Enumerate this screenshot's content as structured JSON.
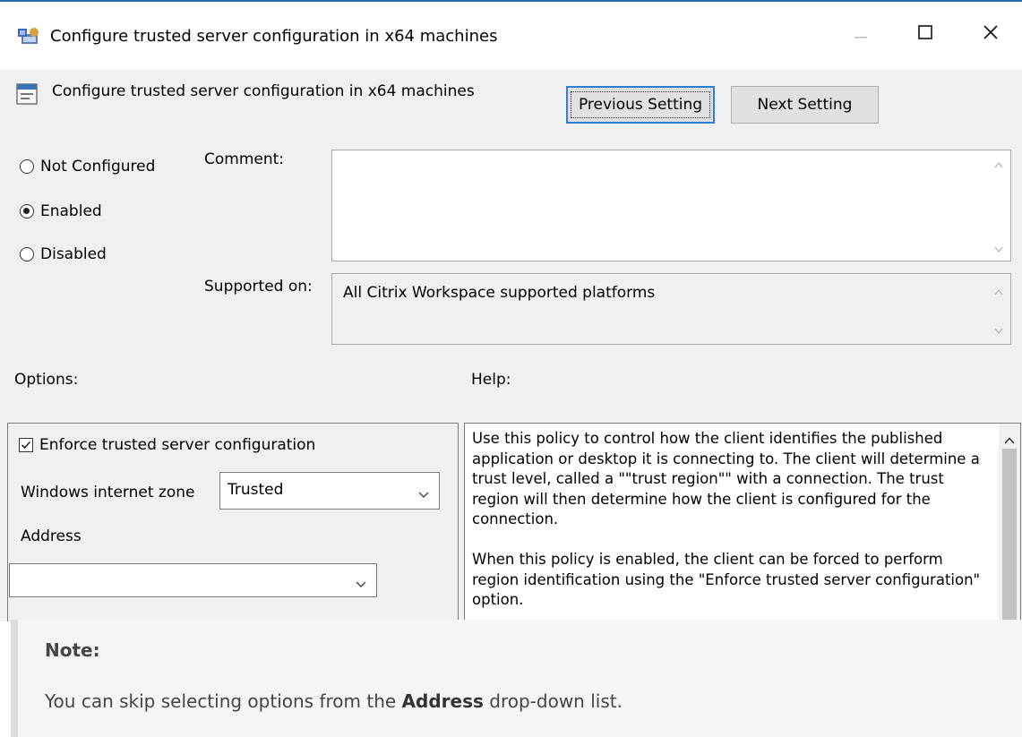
{
  "window": {
    "title": "Configure trusted server configuration in x64 machines",
    "minimize_icon": "minimize-icon",
    "maximize_icon": "maximize-icon",
    "close_icon": "close-icon"
  },
  "setting": {
    "title": "Configure trusted server configuration in x64 machines",
    "previous_label": "Previous Setting",
    "next_label": "Next Setting"
  },
  "state": {
    "options": [
      {
        "label": "Not Configured",
        "selected": false
      },
      {
        "label": "Enabled",
        "selected": true
      },
      {
        "label": "Disabled",
        "selected": false
      }
    ]
  },
  "comment": {
    "label": "Comment:",
    "value": ""
  },
  "supported": {
    "label": "Supported on:",
    "value": "All Citrix Workspace supported platforms"
  },
  "options_section": {
    "label": "Options:",
    "enforce_checkbox": {
      "label": "Enforce trusted server configuration",
      "checked": true
    },
    "zone_label": "Windows internet zone",
    "zone_value": "Trusted",
    "address_label": "Address",
    "address_value": ""
  },
  "help_section": {
    "label": "Help:",
    "paragraph1": "Use this policy to control how the client identifies the published application or desktop it is connecting to.  The client will determine a trust level, called a \"\"trust region\"\" with a connection.  The trust region will then determine how the client is configured for the connection.",
    "paragraph2": "When this policy is enabled, the client can be forced to perform region identification using the \"Enforce trusted server configuration\" option."
  },
  "note": {
    "title": "Note:",
    "text_before": "You can skip selecting options from the ",
    "text_bold": "Address",
    "text_after": " drop-down list."
  },
  "colors": {
    "accent": "#2c7fd6",
    "dialog_bg": "#f0f0f0",
    "note_bg": "#f5f5f5"
  }
}
